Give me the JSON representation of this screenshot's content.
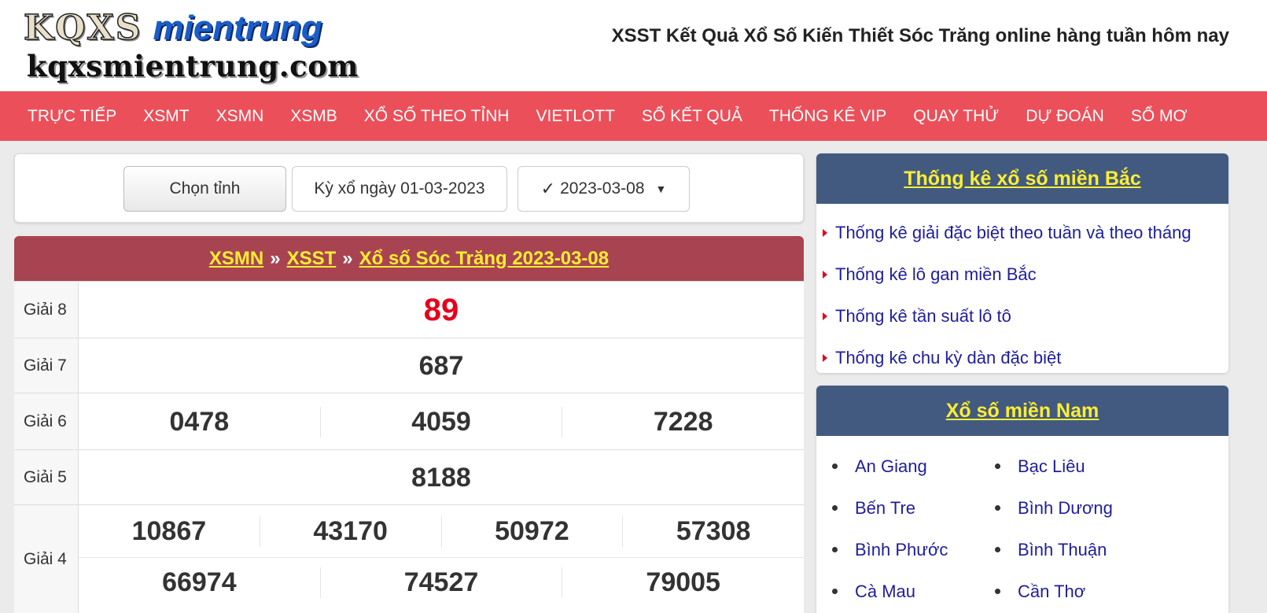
{
  "header": {
    "logo_top_left": "KQXS",
    "logo_top_right": "mientrung",
    "logo_domain": "kqxsmientrung.com",
    "title": "XSST Kết Quả Xổ Số Kiến Thiết Sóc Trăng online hàng tuần hôm nay"
  },
  "nav": [
    "TRỰC TIẾP",
    "XSMT",
    "XSMN",
    "XSMB",
    "XỔ SỐ THEO TỈNH",
    "VIETLOTT",
    "SỔ KẾT QUẢ",
    "THỐNG KÊ VIP",
    "QUAY THỬ",
    "DỰ ĐOÁN",
    "SỔ MƠ"
  ],
  "selector": {
    "province_label": "Chọn tỉnh",
    "date_label": "Kỳ xổ ngày 01-03-2023",
    "compare_check": "✓",
    "compare_value": "2023-03-08",
    "caret": "▼"
  },
  "results": {
    "crumb_1": "XSMN",
    "crumb_2": "XSST",
    "crumb_3": "Xổ số Sóc Trăng 2023-03-08",
    "separator": "»",
    "rows": [
      {
        "label": "Giải 8",
        "lines": [
          [
            "89"
          ]
        ]
      },
      {
        "label": "Giải 7",
        "lines": [
          [
            "687"
          ]
        ]
      },
      {
        "label": "Giải 6",
        "lines": [
          [
            "0478",
            "4059",
            "7228"
          ]
        ]
      },
      {
        "label": "Giải 5",
        "lines": [
          [
            "8188"
          ]
        ]
      },
      {
        "label": "Giải 4",
        "lines": [
          [
            "10867",
            "43170",
            "50972",
            "57308"
          ],
          [
            "66974",
            "74527",
            "79005"
          ]
        ]
      }
    ]
  },
  "stats_box": {
    "title": "Thống kê xổ số miền Bắc",
    "items": [
      "Thống kê giải đặc biệt theo tuần và theo tháng",
      "Thống kê lô gan miền Bắc",
      "Thống kê tần suất lô tô",
      "Thống kê chu kỳ dàn đặc biệt"
    ]
  },
  "south_box": {
    "title": "Xổ số miền Nam",
    "items": [
      "An Giang",
      "Bạc Liêu",
      "Bến Tre",
      "Bình Dương",
      "Bình Phước",
      "Bình Thuận",
      "Cà Mau",
      "Cần Thơ"
    ]
  }
}
